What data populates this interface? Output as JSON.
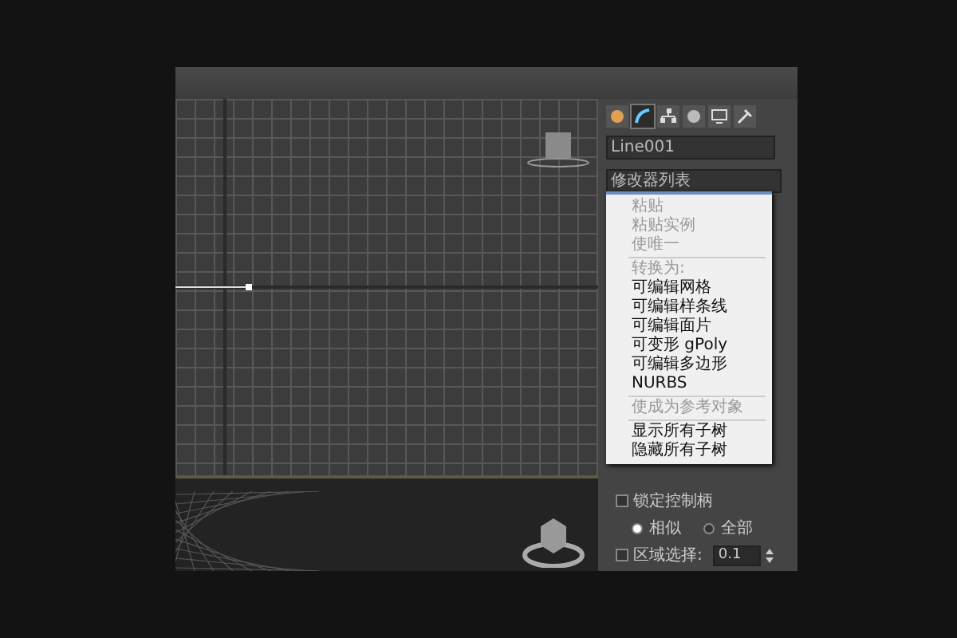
{
  "command_panel": {
    "tabs": [
      {
        "kind": "create",
        "selected": false
      },
      {
        "kind": "modify",
        "selected": true
      },
      {
        "kind": "hierarchy",
        "selected": false
      },
      {
        "kind": "motion",
        "selected": false
      },
      {
        "kind": "display",
        "selected": false
      },
      {
        "kind": "utilities",
        "selected": false
      }
    ],
    "object_name": "Line001",
    "modifier_list": "修改器列表",
    "options": [
      {
        "kind": "checkbox",
        "label": "锁定控制柄",
        "checked": false
      },
      {
        "kind": "radios",
        "items": [
          {
            "label": "相似",
            "selected": true
          },
          {
            "label": "全部",
            "selected": false
          }
        ]
      },
      {
        "kind": "spinner",
        "label": "区域选择:",
        "checked": false,
        "value": "0.1"
      }
    ]
  },
  "context_menu": {
    "items": [
      {
        "kind": "item",
        "label": "粘贴",
        "disabled": true
      },
      {
        "kind": "item",
        "label": "粘贴实例",
        "disabled": true
      },
      {
        "kind": "item",
        "label": "使唯一",
        "disabled": true
      },
      {
        "kind": "separator"
      },
      {
        "kind": "item",
        "label": "转换为:",
        "disabled": true
      },
      {
        "kind": "item",
        "label": "可编辑网格",
        "disabled": false
      },
      {
        "kind": "item",
        "label": "可编辑样条线",
        "disabled": false
      },
      {
        "kind": "item",
        "label": "可编辑面片",
        "disabled": false
      },
      {
        "kind": "item",
        "label": "可变形 gPoly",
        "disabled": false
      },
      {
        "kind": "item",
        "label": "可编辑多边形",
        "disabled": false
      },
      {
        "kind": "item",
        "label": "NURBS",
        "disabled": false
      },
      {
        "kind": "separator"
      },
      {
        "kind": "item",
        "label": "使成为参考对象",
        "disabled": true
      },
      {
        "kind": "separator"
      },
      {
        "kind": "item",
        "label": "显示所有子树",
        "disabled": false
      },
      {
        "kind": "item",
        "label": "隐藏所有子树",
        "disabled": false
      }
    ]
  }
}
